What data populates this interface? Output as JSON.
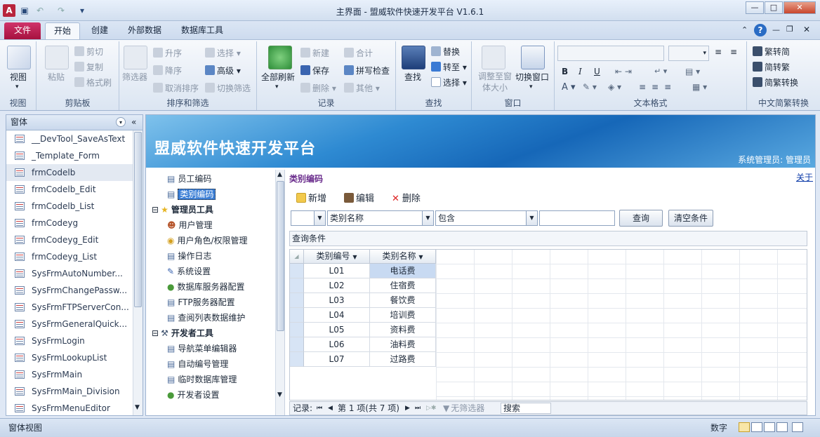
{
  "window": {
    "title": "主界面 - 盟威软件快速开发平台 V1.6.1",
    "app_icon": "A"
  },
  "tabs": [
    {
      "label": "文件",
      "active": false
    },
    {
      "label": "开始",
      "active": true
    },
    {
      "label": "创建",
      "active": false
    },
    {
      "label": "外部数据",
      "active": false
    },
    {
      "label": "数据库工具",
      "active": false
    }
  ],
  "ribbon": {
    "view": {
      "label": "视图",
      "group": "视图"
    },
    "clipboard": {
      "paste": "粘贴",
      "cut": "剪切",
      "copy": "复制",
      "format_painter": "格式刷",
      "group": "剪贴板"
    },
    "sort_filter": {
      "filter": "筛选器",
      "asc": "升序",
      "desc": "降序",
      "remove_sort": "取消排序",
      "selection": "选择",
      "advanced": "高级",
      "toggle_filter": "切换筛选",
      "group": "排序和筛选"
    },
    "records": {
      "refresh_all": "全部刷新",
      "new": "新建",
      "save": "保存",
      "delete": "删除",
      "totals": "合计",
      "spelling": "拼写检查",
      "more": "其他",
      "group": "记录"
    },
    "find": {
      "find": "查找",
      "replace": "替换",
      "goto": "转至",
      "select": "选择",
      "group": "查找"
    },
    "window": {
      "fit": "调整至窗体大小",
      "switch": "切换窗口",
      "group": "窗口"
    },
    "text_format": {
      "bold": "B",
      "italic": "I",
      "underline": "U",
      "group": "文本格式"
    },
    "chinese": {
      "to_simplified": "繁转简",
      "to_traditional": "简转繁",
      "convert": "简繁转换",
      "group": "中文简繁转换"
    }
  },
  "nav": {
    "header": "窗体",
    "items": [
      "__DevTool_SaveAsText",
      "_Template_Form",
      "frmCodelb",
      "frmCodelb_Edit",
      "frmCodelb_List",
      "frmCodeyg",
      "frmCodeyg_Edit",
      "frmCodeyg_List",
      "SysFrmAutoNumber...",
      "SysFrmChangePassw...",
      "SysFrmFTPServerCon...",
      "SysFrmGeneralQuick...",
      "SysFrmLogin",
      "SysFrmLookupList",
      "SysFrmMain",
      "SysFrmMain_Division",
      "SysFrmMenuEditor"
    ],
    "selected_index": 2
  },
  "banner": {
    "title": "盟威软件快速开发平台",
    "user": "系统管理员: 管理员"
  },
  "tree": {
    "nodes": [
      {
        "label": "员工编码",
        "level": 1,
        "icon": "document-icon"
      },
      {
        "label": "类别编码",
        "level": 1,
        "icon": "document-icon",
        "selected": true
      },
      {
        "label": "管理员工具",
        "level": 0,
        "icon": "star-icon"
      },
      {
        "label": "用户管理",
        "level": 1,
        "icon": "users-icon"
      },
      {
        "label": "用户角色/权限管理",
        "level": 1,
        "icon": "lock-icon"
      },
      {
        "label": "操作日志",
        "level": 1,
        "icon": "document-icon"
      },
      {
        "label": "系统设置",
        "level": 1,
        "icon": "settings-icon"
      },
      {
        "label": "数据库服务器配置",
        "level": 1,
        "icon": "database-icon"
      },
      {
        "label": "FTP服务器配置",
        "level": 1,
        "icon": "document-icon"
      },
      {
        "label": "查阅列表数据维护",
        "level": 1,
        "icon": "document-icon"
      },
      {
        "label": "开发者工具",
        "level": 0,
        "icon": "tools-icon"
      },
      {
        "label": "导航菜单编辑器",
        "level": 1,
        "icon": "document-icon"
      },
      {
        "label": "自动编号管理",
        "level": 1,
        "icon": "document-icon"
      },
      {
        "label": "临时数据库管理",
        "level": 1,
        "icon": "document-icon"
      },
      {
        "label": "开发者设置",
        "level": 1,
        "icon": "database-icon"
      }
    ]
  },
  "pane": {
    "title": "类别编码",
    "about": "关于",
    "toolbar": {
      "new": "新增",
      "edit": "编辑",
      "delete": "删除"
    },
    "filter": {
      "field1": "",
      "field2": "类别名称",
      "op": "包含",
      "value": "",
      "query": "查询",
      "clear": "清空条件"
    },
    "condition_label": "查询条件",
    "grid": {
      "columns": [
        "类别编号",
        "类别名称"
      ],
      "rows": [
        [
          "L01",
          "电话费"
        ],
        [
          "L02",
          "住宿费"
        ],
        [
          "L03",
          "餐饮费"
        ],
        [
          "L04",
          "培训费"
        ],
        [
          "L05",
          "资料费"
        ],
        [
          "L06",
          "油料费"
        ],
        [
          "L07",
          "过路费"
        ]
      ]
    },
    "record_nav": {
      "label": "记录:",
      "position": "第 1 项(共 7 项)",
      "filter": "无筛选器",
      "search": "搜索"
    }
  },
  "status": {
    "left": "窗体视图",
    "right": "数字"
  }
}
